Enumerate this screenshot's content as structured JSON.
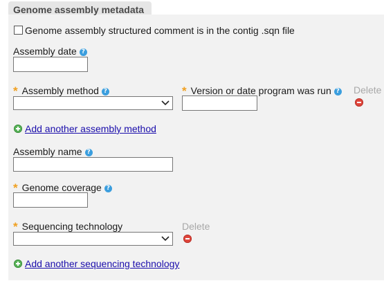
{
  "panel": {
    "title": "Genome assembly metadata"
  },
  "structured_comment": {
    "label": "Genome assembly structured comment is in the contig .sqn file",
    "checked": false
  },
  "assembly_date": {
    "label": "Assembly date",
    "value": ""
  },
  "assembly_method": {
    "label": "Assembly method",
    "selected": "",
    "required": true
  },
  "version_date": {
    "label": "Version or date program was run",
    "value": "",
    "required": true
  },
  "delete_label": "Delete",
  "add_assembly_method": "Add another assembly method",
  "assembly_name": {
    "label": "Assembly name",
    "value": ""
  },
  "genome_coverage": {
    "label": "Genome coverage",
    "value": "",
    "required": true
  },
  "sequencing_technology": {
    "label": "Sequencing technology",
    "selected": "",
    "required": true
  },
  "add_sequencing_technology": "Add another sequencing technology",
  "required_marker": "*",
  "help_glyph": "?",
  "colors": {
    "required": "#f0a020",
    "help": "#3b9ede",
    "remove": "#e0463c",
    "add": "#5ab55a",
    "link": "#1a0dab",
    "panel": "#f2f2f2"
  }
}
